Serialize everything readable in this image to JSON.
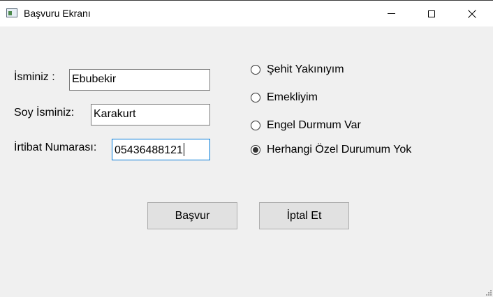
{
  "window": {
    "title": "Başvuru Ekranı"
  },
  "form": {
    "name_label": "İsminiz :",
    "name_value": "Ebubekir",
    "surname_label": "Soy İsminiz:",
    "surname_value": "Karakurt",
    "phone_label": "İrtibat Numarası:",
    "phone_value": "05436488121"
  },
  "options": [
    {
      "label": "Şehit Yakınıyım",
      "checked": false
    },
    {
      "label": "Emekliyim",
      "checked": false
    },
    {
      "label": "Engel Durmum Var",
      "checked": false
    },
    {
      "label": "Herhangi Özel Durumum Yok",
      "checked": true
    }
  ],
  "buttons": {
    "submit_label": "Başvur",
    "cancel_label": "İptal Et"
  },
  "icons": {
    "app": "app-window-icon",
    "minimize": "minimize-icon",
    "maximize": "maximize-icon",
    "close": "close-icon",
    "resize": "resize-grip-icon"
  }
}
